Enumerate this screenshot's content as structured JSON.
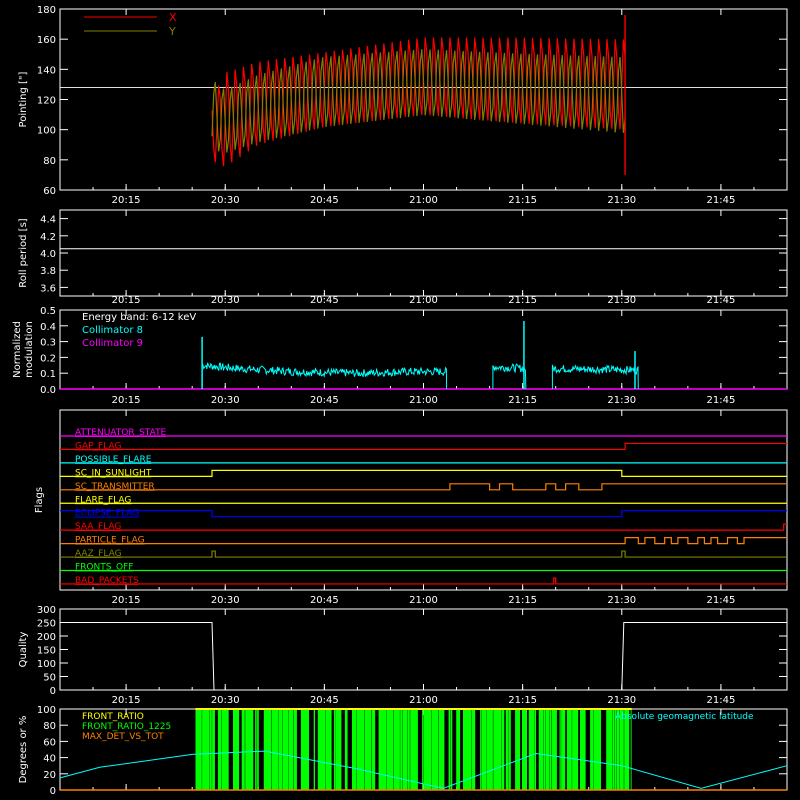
{
  "colors": {
    "background": "#000000",
    "axes": "#ffffff",
    "x_pointing": "#ff0000",
    "y_pointing": "#808000",
    "collimator_8": "#00ffff",
    "collimator_9": "#ff00ff",
    "quality": "#ffffff",
    "front_ratio": "#ffff00",
    "front_ratio_1225": "#00ff00",
    "max_det_vs_tot": "#ff8000",
    "geomag_latitude": "#00ffff"
  },
  "time_axis": {
    "start_min": 1205,
    "end_min": 1315,
    "tick_labels": [
      "20:15",
      "20:30",
      "20:45",
      "21:00",
      "21:15",
      "21:30",
      "21:45"
    ],
    "tick_minutes": [
      1215,
      1230,
      1245,
      1260,
      1275,
      1290,
      1305
    ]
  },
  "chart_data": [
    {
      "type": "line",
      "panel": "pointing",
      "ylabel": "Pointing [\"]",
      "ylim": [
        60,
        180
      ],
      "yticks": [
        60,
        80,
        100,
        120,
        140,
        160,
        180
      ],
      "reference_line": 128,
      "data_span": [
        1228,
        1290.5
      ],
      "series": [
        {
          "name": "X",
          "color": "#ff0000",
          "upper_env": {
            "x": [
              1228,
              1230,
              1235,
              1245,
              1260,
              1275,
              1290
            ],
            "y": [
              122,
              140,
              147,
              153,
              163,
              163,
              162
            ]
          },
          "lower_env": {
            "x": [
              1228,
              1230,
              1235,
              1245,
              1260,
              1275,
              1290
            ],
            "y": [
              78,
              73,
              88,
              100,
              108,
              102,
              98
            ]
          }
        },
        {
          "name": "Y",
          "color": "#808000",
          "upper_env": {
            "x": [
              1228,
              1230,
              1235,
              1245,
              1260,
              1275,
              1290
            ],
            "y": [
              135,
              128,
              138,
              150,
              155,
              152,
              150
            ]
          },
          "lower_env": {
            "x": [
              1228,
              1230,
              1235,
              1245,
              1260,
              1275,
              1290
            ],
            "y": [
              85,
              83,
              90,
              100,
              108,
              102,
              96
            ]
          }
        }
      ]
    },
    {
      "type": "line",
      "panel": "roll_period",
      "ylabel": "Roll period [s]",
      "ylim": [
        3.5,
        4.5
      ],
      "yticks": [
        3.6,
        3.8,
        4.0,
        4.2,
        4.4
      ],
      "ytick_labels": [
        "3.6",
        "3.8",
        "4.0",
        "4.2",
        "4.4"
      ],
      "series": [
        {
          "x": [
            1205,
            1315
          ],
          "y": [
            4.05,
            4.05
          ]
        }
      ]
    },
    {
      "type": "line",
      "panel": "modulation",
      "ylabel": "Normalized modulation",
      "ylim": [
        0,
        0.5
      ],
      "yticks": [
        0.0,
        0.1,
        0.2,
        0.3,
        0.4,
        0.5
      ],
      "ytick_labels": [
        "0.0",
        "0.1",
        "0.2",
        "0.3",
        "0.4",
        "0.5"
      ],
      "annotation": "Energy band: 6-12 keV",
      "series": [
        {
          "name": "Collimator 8",
          "color": "#00ffff",
          "segments": [
            {
              "x": [
                1226.5,
                1232,
                1240,
                1250,
                1258,
                1263.5
              ],
              "y": [
                0.15,
                0.13,
                0.11,
                0.1,
                0.11,
                0.11
              ],
              "spike": {
                "x": 1226.5,
                "y": 0.33
              }
            },
            {
              "x": [
                1270.5,
                1275.5
              ],
              "y": [
                0.14,
                0.13
              ],
              "spike": {
                "x": 1275.2,
                "y": 0.43
              }
            },
            {
              "x": [
                1279.5,
                1292.5
              ],
              "y": [
                0.13,
                0.12
              ],
              "spike": {
                "x": 1292.0,
                "y": 0.24
              }
            }
          ]
        },
        {
          "name": "Collimator 9",
          "color": "#ff00ff",
          "x": [
            1205,
            1315
          ],
          "y": [
            0,
            0
          ]
        }
      ]
    },
    {
      "type": "line",
      "panel": "flags",
      "ylabel": "Flags",
      "flags": [
        {
          "name": "ATTENUATOR_STATE",
          "color": "#ff00ff",
          "transitions": []
        },
        {
          "name": "GAP_FLAG",
          "color": "#ff0000",
          "transitions": [
            1290.5
          ]
        },
        {
          "name": "POSSIBLE_FLARE",
          "color": "#00ffff",
          "transitions": []
        },
        {
          "name": "SC_IN_SUNLIGHT",
          "color": "#ffff00",
          "transitions": [
            1228,
            1290
          ]
        },
        {
          "name": "SC_TRANSMITTER",
          "color": "#ff8000",
          "transitions": [
            1264,
            1270,
            1271.5,
            1273.5,
            1278.5,
            1280,
            1281.5,
            1283.5,
            1287
          ]
        },
        {
          "name": "FLARE_FLAG",
          "color": "#ffff00",
          "transitions": []
        },
        {
          "name": "ECLIPSE_FLAG",
          "color": "#0000ff",
          "transitions": [
            1228,
            1290
          ]
        },
        {
          "name": "SAA_FLAG",
          "color": "#ff0000",
          "transitions": [
            1314.5
          ]
        },
        {
          "name": "PARTICLE_FLAG",
          "color": "#ff8000",
          "transitions": [
            1290.5,
            1292.5,
            1293.5,
            1295,
            1296.5,
            1297.5,
            1298.5,
            1300,
            1301.5,
            1302.5,
            1303.5,
            1304.5,
            1306,
            1307.5,
            1308.5
          ]
        },
        {
          "name": "AAZ_FLAG",
          "color": "#808000",
          "transitions": [
            1228,
            1228.5,
            1290,
            1290.5
          ]
        },
        {
          "name": "FRONTS_OFF",
          "color": "#00ff00",
          "transitions": []
        },
        {
          "name": "BAD_PACKETS",
          "color": "#ff0000",
          "transitions": [
            1279.7,
            1280
          ]
        }
      ]
    },
    {
      "type": "line",
      "panel": "quality",
      "ylabel": "Quality",
      "ylim": [
        0,
        300
      ],
      "yticks": [
        0,
        50,
        100,
        150,
        200,
        250,
        300
      ],
      "series": [
        {
          "x": [
            1205,
            1228,
            1228.3,
            1290,
            1290.3,
            1315
          ],
          "y": [
            250,
            250,
            0,
            0,
            250,
            250
          ]
        }
      ]
    },
    {
      "type": "line",
      "panel": "ratios",
      "ylabel": "Degrees or %",
      "ylim": [
        0,
        100
      ],
      "yticks": [
        0,
        20,
        40,
        60,
        80,
        100
      ],
      "legend_right": "Absolute geomagnetic latitude",
      "series": [
        {
          "name": "FRONT_RATIO",
          "color": "#ffff00",
          "x": [
            1225.5,
            1291.5
          ],
          "y": [
            100,
            100
          ]
        },
        {
          "name": "FRONT_RATIO_1225",
          "color": "#00ff00",
          "span": [
            1225.5,
            1291.5
          ]
        },
        {
          "name": "MAX_DET_VS_TOT",
          "color": "#ff8000",
          "x": [
            1205,
            1315
          ],
          "y": [
            0,
            0
          ]
        },
        {
          "name": "Absolute geomagnetic latitude",
          "color": "#00ffff",
          "x": [
            1205,
            1211,
            1225,
            1236,
            1250,
            1263,
            1277,
            1290,
            1302,
            1315
          ],
          "y": [
            15,
            28,
            44,
            48,
            26,
            2,
            45,
            30,
            2,
            30
          ]
        }
      ]
    }
  ]
}
